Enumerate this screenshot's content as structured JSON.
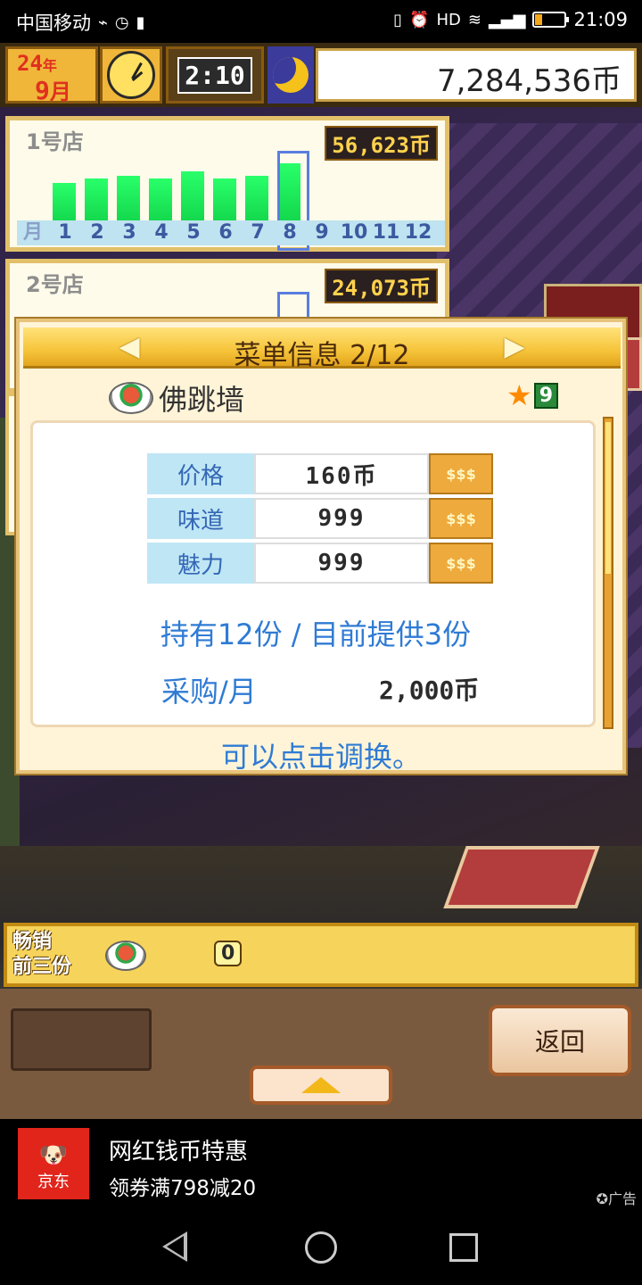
{
  "status_bar": {
    "carrier": "中国移动",
    "time": "21:09",
    "battery_level": 0.22,
    "icons": [
      "activity-icon",
      "timer-icon",
      "sim-icon",
      "vibrate-icon",
      "alarm-icon",
      "hd-icon",
      "wifi-icon",
      "signal-icon",
      "battery-icon"
    ]
  },
  "hud": {
    "year": "24",
    "year_suffix": "年",
    "month": "9",
    "month_suffix": "月",
    "time": "2:10",
    "money": "7,284,536币"
  },
  "shops": [
    {
      "title": "1号店",
      "revenue": "56,623币",
      "bar_values": [
        0.62,
        0.68,
        0.72,
        0.68,
        0.78,
        0.68,
        0.72,
        0.9
      ],
      "selected_month": "8"
    },
    {
      "title": "2号店",
      "revenue": "24,073币"
    }
  ],
  "month_axis": [
    "月",
    "1",
    "2",
    "3",
    "4",
    "5",
    "6",
    "7",
    "8",
    "9",
    "10",
    "11",
    "12"
  ],
  "dialog": {
    "title": "菜单信息 2/12",
    "dish_name": "佛跳墙",
    "rating": "9",
    "stats": [
      {
        "label": "价格",
        "value": "160币",
        "button": "$$$"
      },
      {
        "label": "味道",
        "value": "999",
        "button": "$$$"
      },
      {
        "label": "魅力",
        "value": "999",
        "button": "$$$"
      }
    ],
    "stock_line": "持有12份 / 目前提供3份",
    "purchase_label": "采购/月",
    "purchase_value": "2,000币",
    "hint": "可以点击调换。"
  },
  "bestseller": {
    "label_line1": "畅销",
    "label_line2": "前三份",
    "count": "0"
  },
  "toolbar": {
    "back_label": "返回"
  },
  "ad": {
    "brand": "京东",
    "title": "网红钱币特惠",
    "subtitle": "领券满798减20",
    "tag": "广告"
  },
  "colors": {
    "accent_gold": "#f6c43a",
    "text_blue": "#2f7bd4",
    "bar_green": "#12d44a",
    "brand_red": "#e1251b"
  }
}
